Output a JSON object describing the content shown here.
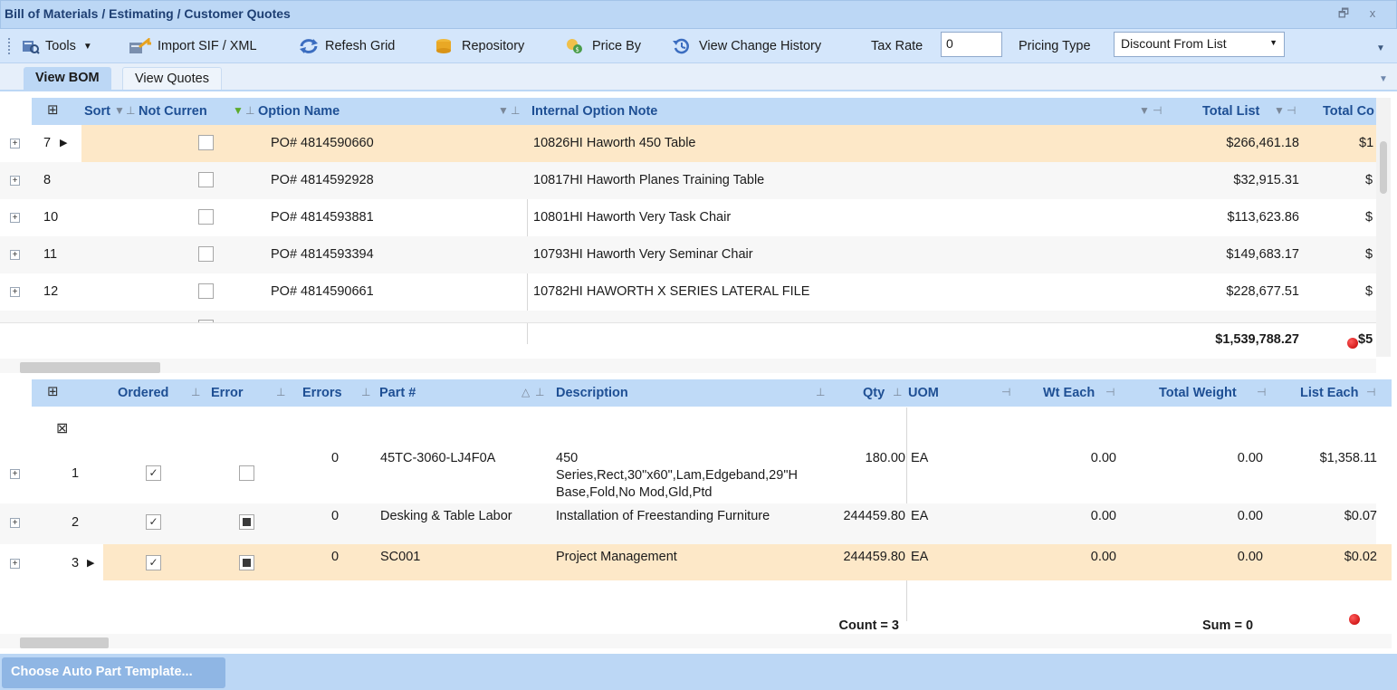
{
  "window": {
    "title": "Bill of Materials / Estimating / Customer Quotes",
    "restore_glyph": "🗗",
    "close_glyph": "x"
  },
  "toolbar": {
    "tools_label": "Tools",
    "import_label": "Import SIF / XML",
    "refresh_label": "Refesh Grid",
    "repository_label": "Repository",
    "price_by_label": "Price By",
    "history_label": "View Change History",
    "tax_rate_label": "Tax Rate",
    "tax_rate_value": "0",
    "pricing_type_label": "Pricing Type",
    "pricing_type_value": "Discount From List"
  },
  "tabs": [
    {
      "label": "View BOM",
      "active": true
    },
    {
      "label": "View Quotes",
      "active": false
    }
  ],
  "bom_grid": {
    "columns": {
      "sort": "Sort",
      "not_current": "Not Curren",
      "option_name": "Option Name",
      "internal_note": "Internal Option Note",
      "total_list": "Total List",
      "total_cost": "Total Co"
    },
    "rows": [
      {
        "sort": "7",
        "not_current": false,
        "option_name": "PO# 4814590660",
        "note": "10826HI Haworth 450 Table",
        "total_list": "$266,461.18",
        "total_cost": "$1",
        "selected": true
      },
      {
        "sort": "8",
        "not_current": false,
        "option_name": "PO# 4814592928",
        "note": "10817HI Haworth Planes Training Table",
        "total_list": "$32,915.31",
        "total_cost": "$",
        "selected": false
      },
      {
        "sort": "10",
        "not_current": false,
        "option_name": "PO# 4814593881",
        "note": "10801HI Haworth Very Task Chair",
        "total_list": "$113,623.86",
        "total_cost": "$",
        "selected": false
      },
      {
        "sort": "11",
        "not_current": false,
        "option_name": "PO# 4814593394",
        "note": "10793HI Haworth Very Seminar Chair",
        "total_list": "$149,683.17",
        "total_cost": "$",
        "selected": false
      },
      {
        "sort": "12",
        "not_current": false,
        "option_name": "PO# 4814590661",
        "note": "10782HI HAWORTH X SERIES LATERAL FILE",
        "total_list": "$228,677.51",
        "total_cost": "$",
        "selected": false
      }
    ],
    "footer": {
      "total_list": "$1,539,788.27",
      "total_cost": "$5"
    }
  },
  "parts_grid": {
    "columns": {
      "ordered": "Ordered",
      "error": "Error",
      "errors": "Errors",
      "part_no": "Part #",
      "description": "Description",
      "qty": "Qty",
      "uom": "UOM",
      "wt_each": "Wt Each",
      "total_weight": "Total Weight",
      "list_each": "List Each"
    },
    "rows": [
      {
        "num": "1",
        "ordered": true,
        "error": "none",
        "errors": "0",
        "part_no": "45TC-3060-LJ4F0A",
        "desc_lines": [
          "450",
          "Series,Rect,30\"x60\",Lam,Edgeband,29\"H",
          "Base,Fold,No Mod,Gld,Ptd"
        ],
        "qty": "180.00",
        "uom": "EA",
        "wt_each": "0.00",
        "total_weight": "0.00",
        "list_each": "$1,358.11",
        "selected": false
      },
      {
        "num": "2",
        "ordered": true,
        "error": "filled",
        "errors": "0",
        "part_no": "Desking & Table Labor",
        "desc_lines": [
          "Installation of Freestanding Furniture"
        ],
        "qty": "244459.80",
        "uom": "EA",
        "wt_each": "0.00",
        "total_weight": "0.00",
        "list_each": "$0.07",
        "selected": false
      },
      {
        "num": "3",
        "ordered": true,
        "error": "filled",
        "errors": "0",
        "part_no": "SC001",
        "desc_lines": [
          "Project Management"
        ],
        "qty": "244459.80",
        "uom": "EA",
        "wt_each": "0.00",
        "total_weight": "0.00",
        "list_each": "$0.02",
        "selected": true
      }
    ],
    "footer": {
      "count": "Count = 3",
      "sum": "Sum = 0"
    }
  },
  "bottom": {
    "template_button": "Choose Auto Part Template..."
  },
  "colors": {
    "accent": "#bcd7f5",
    "header_text": "#1e4f94",
    "selected_row": "#fde8c8",
    "error_dot": "#c00000"
  }
}
